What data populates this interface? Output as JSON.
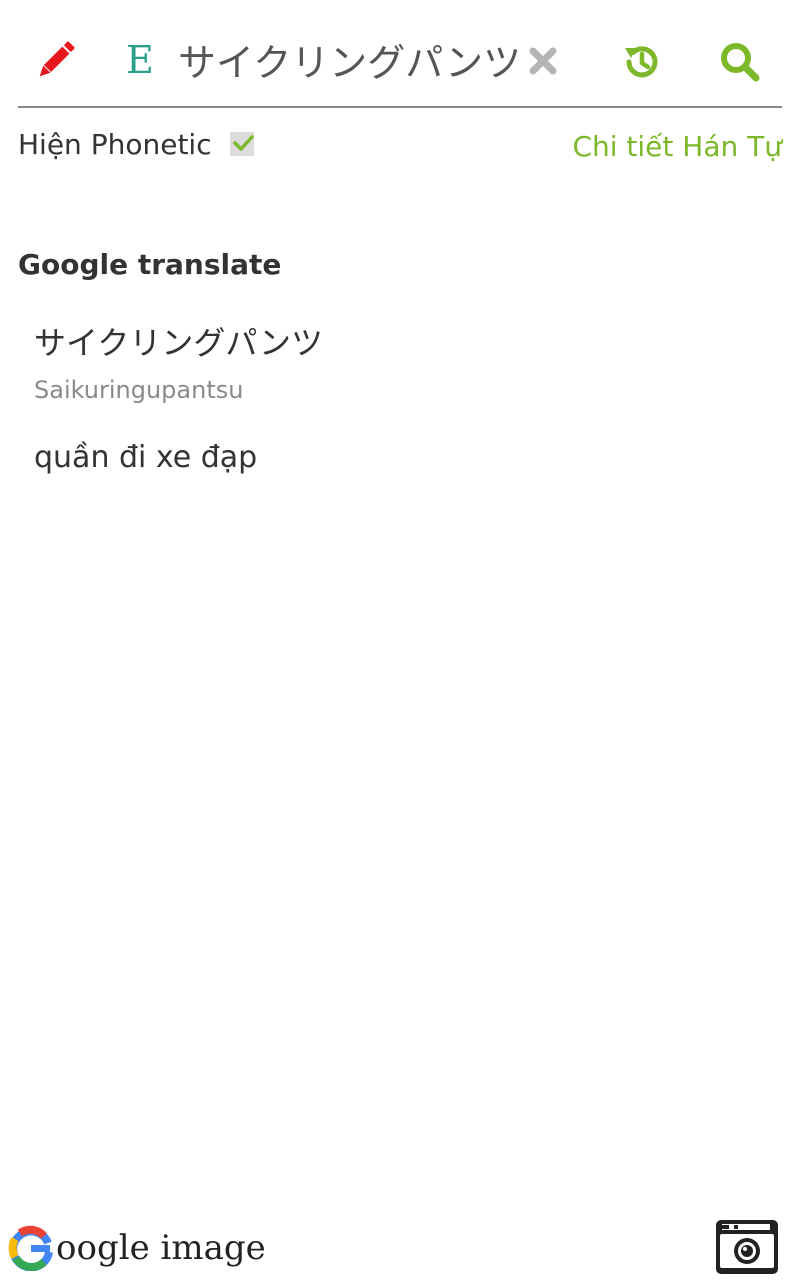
{
  "toolbar": {
    "mode_letter": "E",
    "search_value": "サイクリングパンツ",
    "icons": {
      "edit": "pencil-icon",
      "clear": "close-icon",
      "history": "history-icon",
      "search": "search-icon"
    }
  },
  "phonetic_toggle": {
    "label": "Hiện Phonetic",
    "checked": true
  },
  "kanji_link": "Chi tiết Hán Tự",
  "result": {
    "section_title": "Google translate",
    "source_text": "サイクリングパンツ",
    "phonetic": "Saikuringupantsu",
    "translation": "quần đi xe đạp"
  },
  "footer": {
    "google_image_label": "oogle image",
    "icons": {
      "google_logo": "google-g-icon",
      "camera": "camera-icon"
    }
  },
  "colors": {
    "accent_green": "#7cb82a",
    "edit_red": "#e8161d",
    "mode_teal": "#2aa08c",
    "clear_gray": "#b5b5b5"
  }
}
